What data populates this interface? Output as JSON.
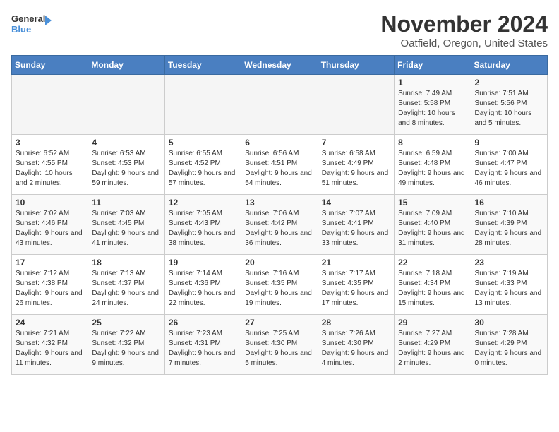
{
  "logo": {
    "line1": "General",
    "line2": "Blue"
  },
  "title": "November 2024",
  "subtitle": "Oatfield, Oregon, United States",
  "days_header": [
    "Sunday",
    "Monday",
    "Tuesday",
    "Wednesday",
    "Thursday",
    "Friday",
    "Saturday"
  ],
  "weeks": [
    [
      {
        "day": "",
        "info": ""
      },
      {
        "day": "",
        "info": ""
      },
      {
        "day": "",
        "info": ""
      },
      {
        "day": "",
        "info": ""
      },
      {
        "day": "",
        "info": ""
      },
      {
        "day": "1",
        "info": "Sunrise: 7:49 AM\nSunset: 5:58 PM\nDaylight: 10 hours and 8 minutes."
      },
      {
        "day": "2",
        "info": "Sunrise: 7:51 AM\nSunset: 5:56 PM\nDaylight: 10 hours and 5 minutes."
      }
    ],
    [
      {
        "day": "3",
        "info": "Sunrise: 6:52 AM\nSunset: 4:55 PM\nDaylight: 10 hours and 2 minutes."
      },
      {
        "day": "4",
        "info": "Sunrise: 6:53 AM\nSunset: 4:53 PM\nDaylight: 9 hours and 59 minutes."
      },
      {
        "day": "5",
        "info": "Sunrise: 6:55 AM\nSunset: 4:52 PM\nDaylight: 9 hours and 57 minutes."
      },
      {
        "day": "6",
        "info": "Sunrise: 6:56 AM\nSunset: 4:51 PM\nDaylight: 9 hours and 54 minutes."
      },
      {
        "day": "7",
        "info": "Sunrise: 6:58 AM\nSunset: 4:49 PM\nDaylight: 9 hours and 51 minutes."
      },
      {
        "day": "8",
        "info": "Sunrise: 6:59 AM\nSunset: 4:48 PM\nDaylight: 9 hours and 49 minutes."
      },
      {
        "day": "9",
        "info": "Sunrise: 7:00 AM\nSunset: 4:47 PM\nDaylight: 9 hours and 46 minutes."
      }
    ],
    [
      {
        "day": "10",
        "info": "Sunrise: 7:02 AM\nSunset: 4:46 PM\nDaylight: 9 hours and 43 minutes."
      },
      {
        "day": "11",
        "info": "Sunrise: 7:03 AM\nSunset: 4:45 PM\nDaylight: 9 hours and 41 minutes."
      },
      {
        "day": "12",
        "info": "Sunrise: 7:05 AM\nSunset: 4:43 PM\nDaylight: 9 hours and 38 minutes."
      },
      {
        "day": "13",
        "info": "Sunrise: 7:06 AM\nSunset: 4:42 PM\nDaylight: 9 hours and 36 minutes."
      },
      {
        "day": "14",
        "info": "Sunrise: 7:07 AM\nSunset: 4:41 PM\nDaylight: 9 hours and 33 minutes."
      },
      {
        "day": "15",
        "info": "Sunrise: 7:09 AM\nSunset: 4:40 PM\nDaylight: 9 hours and 31 minutes."
      },
      {
        "day": "16",
        "info": "Sunrise: 7:10 AM\nSunset: 4:39 PM\nDaylight: 9 hours and 28 minutes."
      }
    ],
    [
      {
        "day": "17",
        "info": "Sunrise: 7:12 AM\nSunset: 4:38 PM\nDaylight: 9 hours and 26 minutes."
      },
      {
        "day": "18",
        "info": "Sunrise: 7:13 AM\nSunset: 4:37 PM\nDaylight: 9 hours and 24 minutes."
      },
      {
        "day": "19",
        "info": "Sunrise: 7:14 AM\nSunset: 4:36 PM\nDaylight: 9 hours and 22 minutes."
      },
      {
        "day": "20",
        "info": "Sunrise: 7:16 AM\nSunset: 4:35 PM\nDaylight: 9 hours and 19 minutes."
      },
      {
        "day": "21",
        "info": "Sunrise: 7:17 AM\nSunset: 4:35 PM\nDaylight: 9 hours and 17 minutes."
      },
      {
        "day": "22",
        "info": "Sunrise: 7:18 AM\nSunset: 4:34 PM\nDaylight: 9 hours and 15 minutes."
      },
      {
        "day": "23",
        "info": "Sunrise: 7:19 AM\nSunset: 4:33 PM\nDaylight: 9 hours and 13 minutes."
      }
    ],
    [
      {
        "day": "24",
        "info": "Sunrise: 7:21 AM\nSunset: 4:32 PM\nDaylight: 9 hours and 11 minutes."
      },
      {
        "day": "25",
        "info": "Sunrise: 7:22 AM\nSunset: 4:32 PM\nDaylight: 9 hours and 9 minutes."
      },
      {
        "day": "26",
        "info": "Sunrise: 7:23 AM\nSunset: 4:31 PM\nDaylight: 9 hours and 7 minutes."
      },
      {
        "day": "27",
        "info": "Sunrise: 7:25 AM\nSunset: 4:30 PM\nDaylight: 9 hours and 5 minutes."
      },
      {
        "day": "28",
        "info": "Sunrise: 7:26 AM\nSunset: 4:30 PM\nDaylight: 9 hours and 4 minutes."
      },
      {
        "day": "29",
        "info": "Sunrise: 7:27 AM\nSunset: 4:29 PM\nDaylight: 9 hours and 2 minutes."
      },
      {
        "day": "30",
        "info": "Sunrise: 7:28 AM\nSunset: 4:29 PM\nDaylight: 9 hours and 0 minutes."
      }
    ]
  ]
}
